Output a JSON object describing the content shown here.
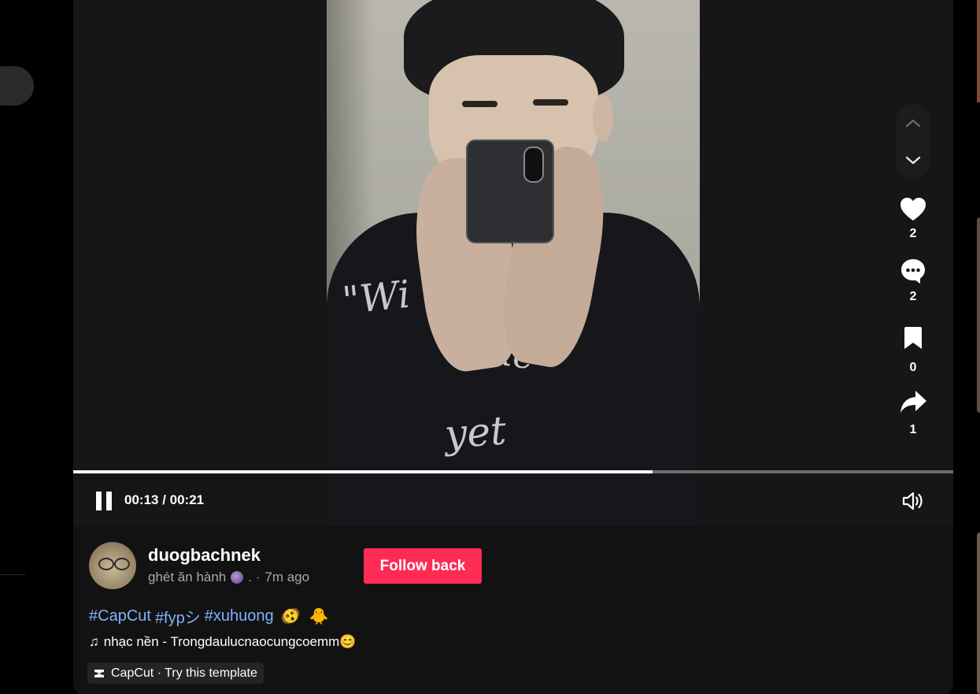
{
  "video": {
    "shirt_print": [
      "\"Wi",
      "nke",
      "yet"
    ],
    "progress_fraction": 0.658,
    "time_display": "00:13 / 00:21"
  },
  "actions": {
    "likes": "2",
    "comments": "2",
    "saves": "0",
    "shares": "1"
  },
  "author": {
    "username": "duogbachnek",
    "nickname": "ghét ăn hành",
    "separator": ". ·",
    "posted": "7m ago",
    "follow_label": "Follow back"
  },
  "caption": {
    "hashtags": [
      "#CapCut",
      "#fypシ",
      "#xuhuong"
    ],
    "emojis": [
      "🫨",
      "🐥"
    ]
  },
  "music": {
    "icon": "♫",
    "title": "nhạc nền - Trongdaulucnaocungcoemm😊"
  },
  "template": {
    "label": "CapCut · Try this template"
  },
  "colors": {
    "accent": "#fe2c55",
    "hashtag": "#7fb2ff",
    "background": "#121212"
  }
}
